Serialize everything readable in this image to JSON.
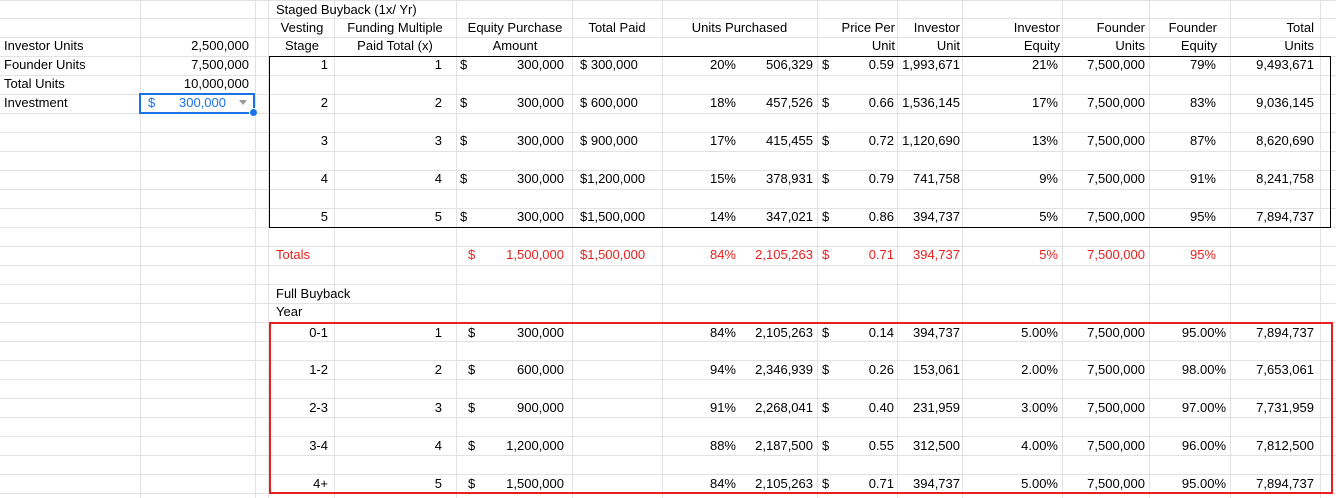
{
  "params": [
    {
      "label": "Investor Units",
      "value": "2,500,000"
    },
    {
      "label": "Founder Units",
      "value": "7,500,000"
    },
    {
      "label": "Total Units",
      "value": "10,000,000"
    },
    {
      "label": "Investment",
      "dollar": "$",
      "value": "300,000"
    }
  ],
  "staged": {
    "title": "Staged Buyback (1x/ Yr)",
    "headers": [
      {
        "line1": "Vesting",
        "line2": "Stage"
      },
      {
        "line1": "Funding Multiple",
        "line2": "Paid Total (x)"
      },
      {
        "line1": "Equity Purchase",
        "line2": "Amount"
      },
      {
        "line1": "Total Paid",
        "line2": ""
      },
      {
        "line1": "Units Purchased",
        "line2": ""
      },
      {
        "line1": "Price Per",
        "line2": "Unit"
      },
      {
        "line1": "Investor",
        "line2": "Unit"
      },
      {
        "line1": "Investor",
        "line2": "Equity"
      },
      {
        "line1": "Founder",
        "line2": "Units"
      },
      {
        "line1": "Founder",
        "line2": "Equity"
      },
      {
        "line1": "Total",
        "line2": "Units"
      }
    ],
    "rows": [
      {
        "stage": "1",
        "multiple": "1",
        "d1": "$",
        "amount": "300,000",
        "paid": "$  300,000",
        "pct": "20%",
        "units": "506,329",
        "d2": "$",
        "price": "0.59",
        "inv_unit": "1,993,671",
        "inv_eq": "21%",
        "founder_units": "7,500,000",
        "founder_eq": "79%",
        "total_units": "9,493,671"
      },
      {
        "stage": "2",
        "multiple": "2",
        "d1": "$",
        "amount": "300,000",
        "paid": "$  600,000",
        "pct": "18%",
        "units": "457,526",
        "d2": "$",
        "price": "0.66",
        "inv_unit": "1,536,145",
        "inv_eq": "17%",
        "founder_units": "7,500,000",
        "founder_eq": "83%",
        "total_units": "9,036,145"
      },
      {
        "stage": "3",
        "multiple": "3",
        "d1": "$",
        "amount": "300,000",
        "paid": "$  900,000",
        "pct": "17%",
        "units": "415,455",
        "d2": "$",
        "price": "0.72",
        "inv_unit": "1,120,690",
        "inv_eq": "13%",
        "founder_units": "7,500,000",
        "founder_eq": "87%",
        "total_units": "8,620,690"
      },
      {
        "stage": "4",
        "multiple": "4",
        "d1": "$",
        "amount": "300,000",
        "paid": "$1,200,000",
        "pct": "15%",
        "units": "378,931",
        "d2": "$",
        "price": "0.79",
        "inv_unit": "741,758",
        "inv_eq": "9%",
        "founder_units": "7,500,000",
        "founder_eq": "91%",
        "total_units": "8,241,758"
      },
      {
        "stage": "5",
        "multiple": "5",
        "d1": "$",
        "amount": "300,000",
        "paid": "$1,500,000",
        "pct": "14%",
        "units": "347,021",
        "d2": "$",
        "price": "0.86",
        "inv_unit": "394,737",
        "inv_eq": "5%",
        "founder_units": "7,500,000",
        "founder_eq": "95%",
        "total_units": "7,894,737"
      }
    ],
    "totals": {
      "label": "Totals",
      "d1": "$",
      "amount": "1,500,000",
      "paid": "$1,500,000",
      "pct": "84%",
      "units": "2,105,263",
      "d2": "$",
      "price": "0.71",
      "inv_unit": "394,737",
      "inv_eq": "5%",
      "founder_units": "7,500,000",
      "founder_eq": "95%"
    }
  },
  "full": {
    "title": "Full Buyback",
    "subtitle": "Year",
    "rows": [
      {
        "year": "0-1",
        "multiple": "1",
        "d1": "$",
        "amount": "300,000",
        "pct": "84%",
        "units": "2,105,263",
        "d2": "$",
        "price": "0.14",
        "inv_unit": "394,737",
        "inv_eq": "5.00%",
        "founder_units": "7,500,000",
        "founder_eq": "95.00%",
        "total_units": "7,894,737"
      },
      {
        "year": "1-2",
        "multiple": "2",
        "d1": "$",
        "amount": "600,000",
        "pct": "94%",
        "units": "2,346,939",
        "d2": "$",
        "price": "0.26",
        "inv_unit": "153,061",
        "inv_eq": "2.00%",
        "founder_units": "7,500,000",
        "founder_eq": "98.00%",
        "total_units": "7,653,061"
      },
      {
        "year": "2-3",
        "multiple": "3",
        "d1": "$",
        "amount": "900,000",
        "pct": "91%",
        "units": "2,268,041",
        "d2": "$",
        "price": "0.40",
        "inv_unit": "231,959",
        "inv_eq": "3.00%",
        "founder_units": "7,500,000",
        "founder_eq": "97.00%",
        "total_units": "7,731,959"
      },
      {
        "year": "3-4",
        "multiple": "4",
        "d1": "$",
        "amount": "1,200,000",
        "pct": "88%",
        "units": "2,187,500",
        "d2": "$",
        "price": "0.55",
        "inv_unit": "312,500",
        "inv_eq": "4.00%",
        "founder_units": "7,500,000",
        "founder_eq": "96.00%",
        "total_units": "7,812,500"
      },
      {
        "year": "4+",
        "multiple": "5",
        "d1": "$",
        "amount": "1,500,000",
        "pct": "84%",
        "units": "2,105,263",
        "d2": "$",
        "price": "0.71",
        "inv_unit": "394,737",
        "inv_eq": "5.00%",
        "founder_units": "7,500,000",
        "founder_eq": "95.00%",
        "total_units": "7,894,737"
      }
    ]
  },
  "colors": {
    "accent": "#1a73e8",
    "totals": "#e8201d",
    "highlight_border": "#e8201d"
  }
}
